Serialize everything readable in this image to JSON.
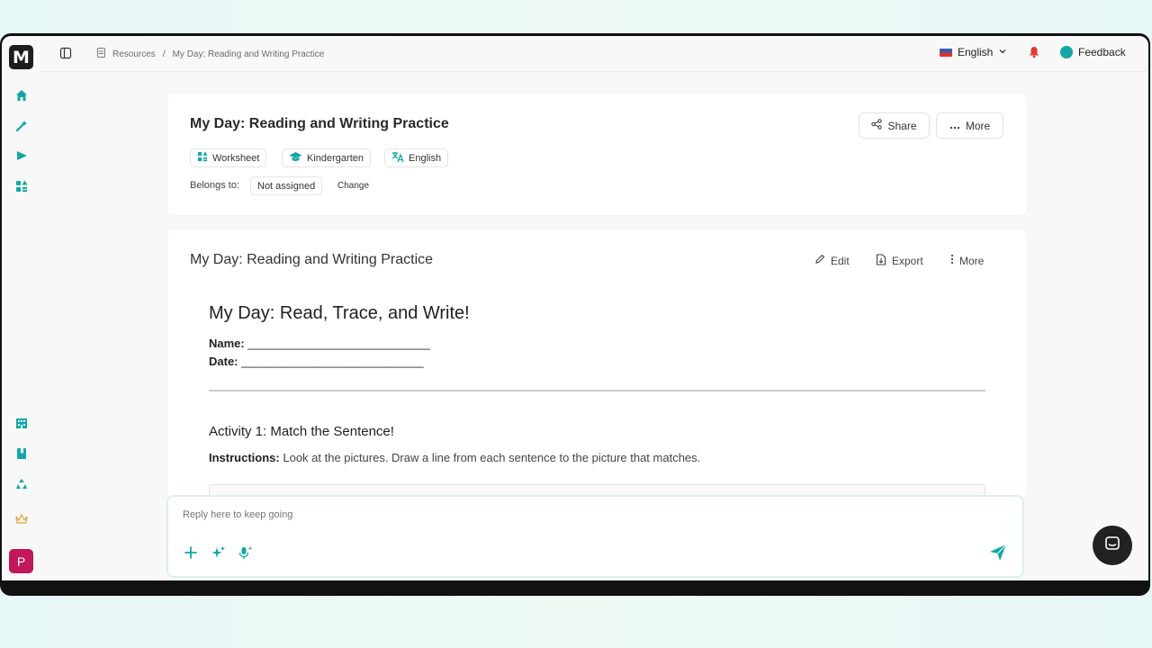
{
  "breadcrumb": {
    "root": "Resources",
    "separator": "/",
    "current": "My Day: Reading and Writing Practice"
  },
  "header": {
    "language": "English",
    "feedback": "Feedback"
  },
  "resource": {
    "title": "My Day: Reading and Writing Practice",
    "share_label": "Share",
    "more_label": "More",
    "tags": {
      "type": "Worksheet",
      "grade": "Kindergarten",
      "language": "English"
    },
    "belongs_label": "Belongs to:",
    "belongs_value": "Not assigned",
    "change_label": "Change"
  },
  "document": {
    "title": "My Day: Reading and Writing Practice",
    "edit_label": "Edit",
    "export_label": "Export",
    "more_label": "More",
    "heading": "My Day: Read, Trace, and Write!",
    "name_label": "Name:",
    "name_blank": "____________________________",
    "date_label": "Date:",
    "date_blank": "____________________________",
    "activity_heading": "Activity 1: Match the Sentence!",
    "instructions_label": "Instructions:",
    "instructions_text": "Look at the pictures. Draw a line from each sentence to the picture that matches."
  },
  "composer": {
    "placeholder": "Reply here to keep going"
  },
  "user": {
    "initial": "P"
  },
  "brand": {
    "logo": "M",
    "accent": "#12a7a7",
    "avatar_color": "#c2185b"
  }
}
